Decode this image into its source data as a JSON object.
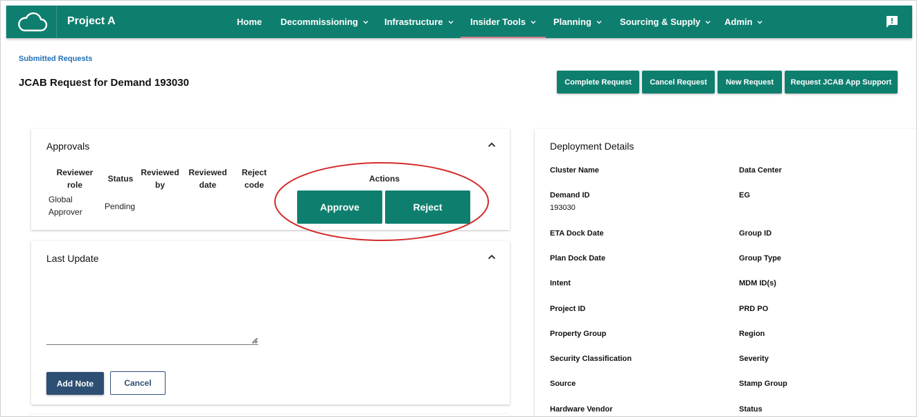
{
  "app": {
    "brand": "Project A"
  },
  "nav": {
    "items": [
      {
        "label": "Home",
        "dropdown": false
      },
      {
        "label": "Decommissioning",
        "dropdown": true
      },
      {
        "label": "Infrastructure",
        "dropdown": true
      },
      {
        "label": "Insider Tools",
        "dropdown": true,
        "active": true
      },
      {
        "label": "Planning",
        "dropdown": true
      },
      {
        "label": "Sourcing & Supply",
        "dropdown": true
      },
      {
        "label": "Admin",
        "dropdown": true
      }
    ]
  },
  "breadcrumb": "Submitted Requests",
  "page_title": "JCAB Request for Demand 193030",
  "toolbar": {
    "complete": "Complete Request",
    "cancel": "Cancel Request",
    "new": "New Request",
    "support": "Request JCAB App Support"
  },
  "approvals": {
    "title": "Approvals",
    "headers": {
      "role_1": "Reviewer",
      "role_2": "role",
      "status": "Status",
      "by_1": "Reviewed",
      "by_2": "by",
      "date_1": "Reviewed",
      "date_2": "date",
      "code_1": "Reject",
      "code_2": "code",
      "actions": "Actions"
    },
    "row": {
      "role_1": "Global",
      "role_2": "Approver",
      "status": "Pending"
    },
    "approve_label": "Approve",
    "reject_label": "Reject"
  },
  "last_update": {
    "title": "Last Update",
    "note_placeholder": "",
    "add_label": "Add Note",
    "cancel_label": "Cancel"
  },
  "deployment": {
    "title": "Deployment Details",
    "left": [
      {
        "label": "Cluster Name",
        "value": ""
      },
      {
        "label": "Demand ID",
        "value": "193030"
      },
      {
        "label": "ETA Dock Date",
        "value": ""
      },
      {
        "label": "Plan Dock Date",
        "value": ""
      },
      {
        "label": "Intent",
        "value": ""
      },
      {
        "label": "Project ID",
        "value": ""
      },
      {
        "label": "Property Group",
        "value": ""
      },
      {
        "label": "Security Classification",
        "value": ""
      },
      {
        "label": "Source",
        "value": ""
      },
      {
        "label": "Hardware Vendor",
        "value": ""
      }
    ],
    "right": [
      {
        "label": "Data Center",
        "value": ""
      },
      {
        "label": "EG",
        "value": ""
      },
      {
        "label": "Group ID",
        "value": ""
      },
      {
        "label": "Group Type",
        "value": ""
      },
      {
        "label": "MDM ID(s)",
        "value": ""
      },
      {
        "label": "PRD PO",
        "value": ""
      },
      {
        "label": "Region",
        "value": ""
      },
      {
        "label": "Severity",
        "value": ""
      },
      {
        "label": "Stamp Group",
        "value": ""
      },
      {
        "label": "Status",
        "value": ""
      }
    ]
  },
  "colors": {
    "primary": "#0e7f6f",
    "secondary": "#2d4f73",
    "link": "#1f6fb7",
    "highlight": "#d42a2a"
  },
  "icons": {
    "logo": "cloud-icon",
    "feedback": "feedback-icon",
    "collapse": "chevron-up-icon",
    "dropdown": "chevron-down-icon"
  }
}
